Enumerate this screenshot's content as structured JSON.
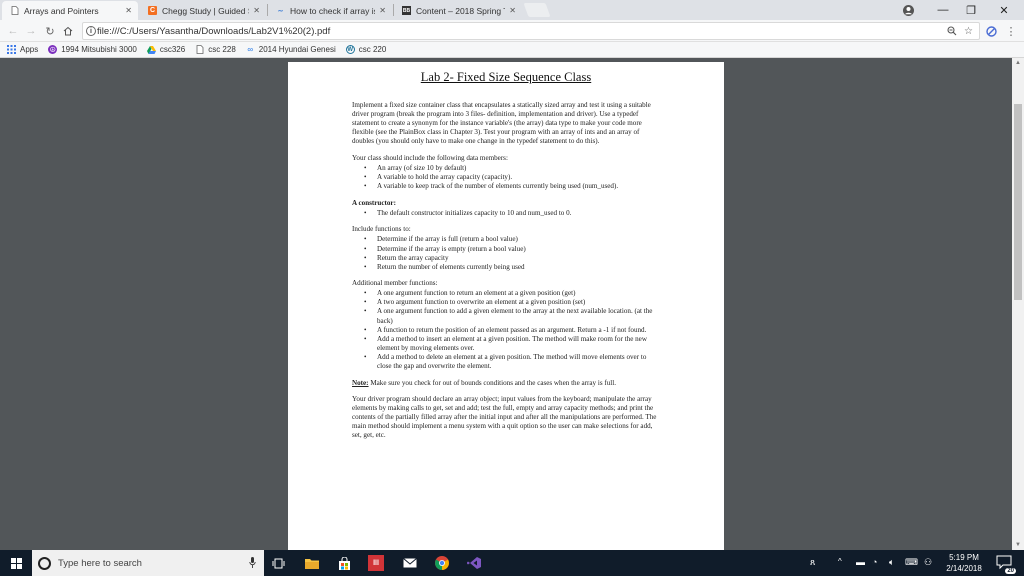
{
  "tabs": [
    {
      "title": "Arrays and Pointers",
      "icon": "page-icon"
    },
    {
      "title": "Chegg Study | Guided So",
      "icon": "chegg-icon"
    },
    {
      "title": "How to check if array is",
      "icon": "qa-icon"
    },
    {
      "title": "Content – 2018 Spring Te",
      "icon": "d2l-icon"
    }
  ],
  "window": {
    "minimize": "—",
    "restore": "❐",
    "close": "✕"
  },
  "address": {
    "url": "file:///C:/Users/Yasantha/Downloads/Lab2V1%20(2).pdf"
  },
  "bookmarks": [
    {
      "label": "Apps",
      "icon": "apps-icon"
    },
    {
      "label": "1994 Mitsubishi 3000",
      "icon": "peace-icon"
    },
    {
      "label": "csc326",
      "icon": "drive-icon"
    },
    {
      "label": "csc 228",
      "icon": "doc-icon"
    },
    {
      "label": "2014 Hyundai Genesi",
      "icon": "link-icon"
    },
    {
      "label": "csc 220",
      "icon": "wordpress-icon"
    }
  ],
  "document": {
    "title": "Lab 2- Fixed Size Sequence Class",
    "intro": "Implement a fixed size container class that encapsulates a statically sized array and test it using a suitable driver program (break the program into 3 files- definition, implementation and driver). Use a typedef statement to create a synonym for the instance variable's (the array) data type to make your code more flexible (see the PlainBox class in Chapter 3). Test your program with an array of ints and an array of doubles (you should only have to make one change in the typedef statement to do this).",
    "members_heading": "Your class should include the following data members:",
    "members": [
      "An array (of size 10 by default)",
      "A variable to hold the array capacity (capacity).",
      "A variable to keep track of the number of elements currently being used (num_used)."
    ],
    "constructor_heading": "A constructor:",
    "constructor_items": [
      "The default constructor initializes capacity to 10 and num_used to 0."
    ],
    "functions_heading": "Include functions to:",
    "functions": [
      "Determine if the array is full (return a bool value)",
      "Determine if the array is empty (return a bool value)",
      "Return the array capacity",
      "Return the number of elements currently being used"
    ],
    "additional_heading": "Additional member functions:",
    "additional": [
      "A one argument function to return an element at a given position (get)",
      "A two argument function to overwrite an element at a given position (set)",
      "A one argument function to add a given element to the array at the next available location. (at the back)",
      "A function to return the position of an element passed as an argument. Return a -1 if not found.",
      "Add a method to insert an element at a given position. The method will make room for the new element by moving elements over.",
      "Add a method to delete an element at a given position. The method will move elements over to close the gap and overwrite the element."
    ],
    "note_label": "Note:",
    "note_text": "Make sure you check for out of bounds conditions and the cases when the array is full.",
    "driver": "Your driver program should declare an array object; input values from the keyboard; manipulate the array elements by making calls to get, set and add; test the full, empty and array capacity methods; and print the contents of the partially filled array after the initial input and after all the manipulations are performed. The main method should implement a menu system with a quit option so the user can make selections for add, set, get, etc."
  },
  "taskbar": {
    "search_placeholder": "Type here to search",
    "time": "5:19 PM",
    "date": "2/14/2018",
    "notifications": "20"
  }
}
